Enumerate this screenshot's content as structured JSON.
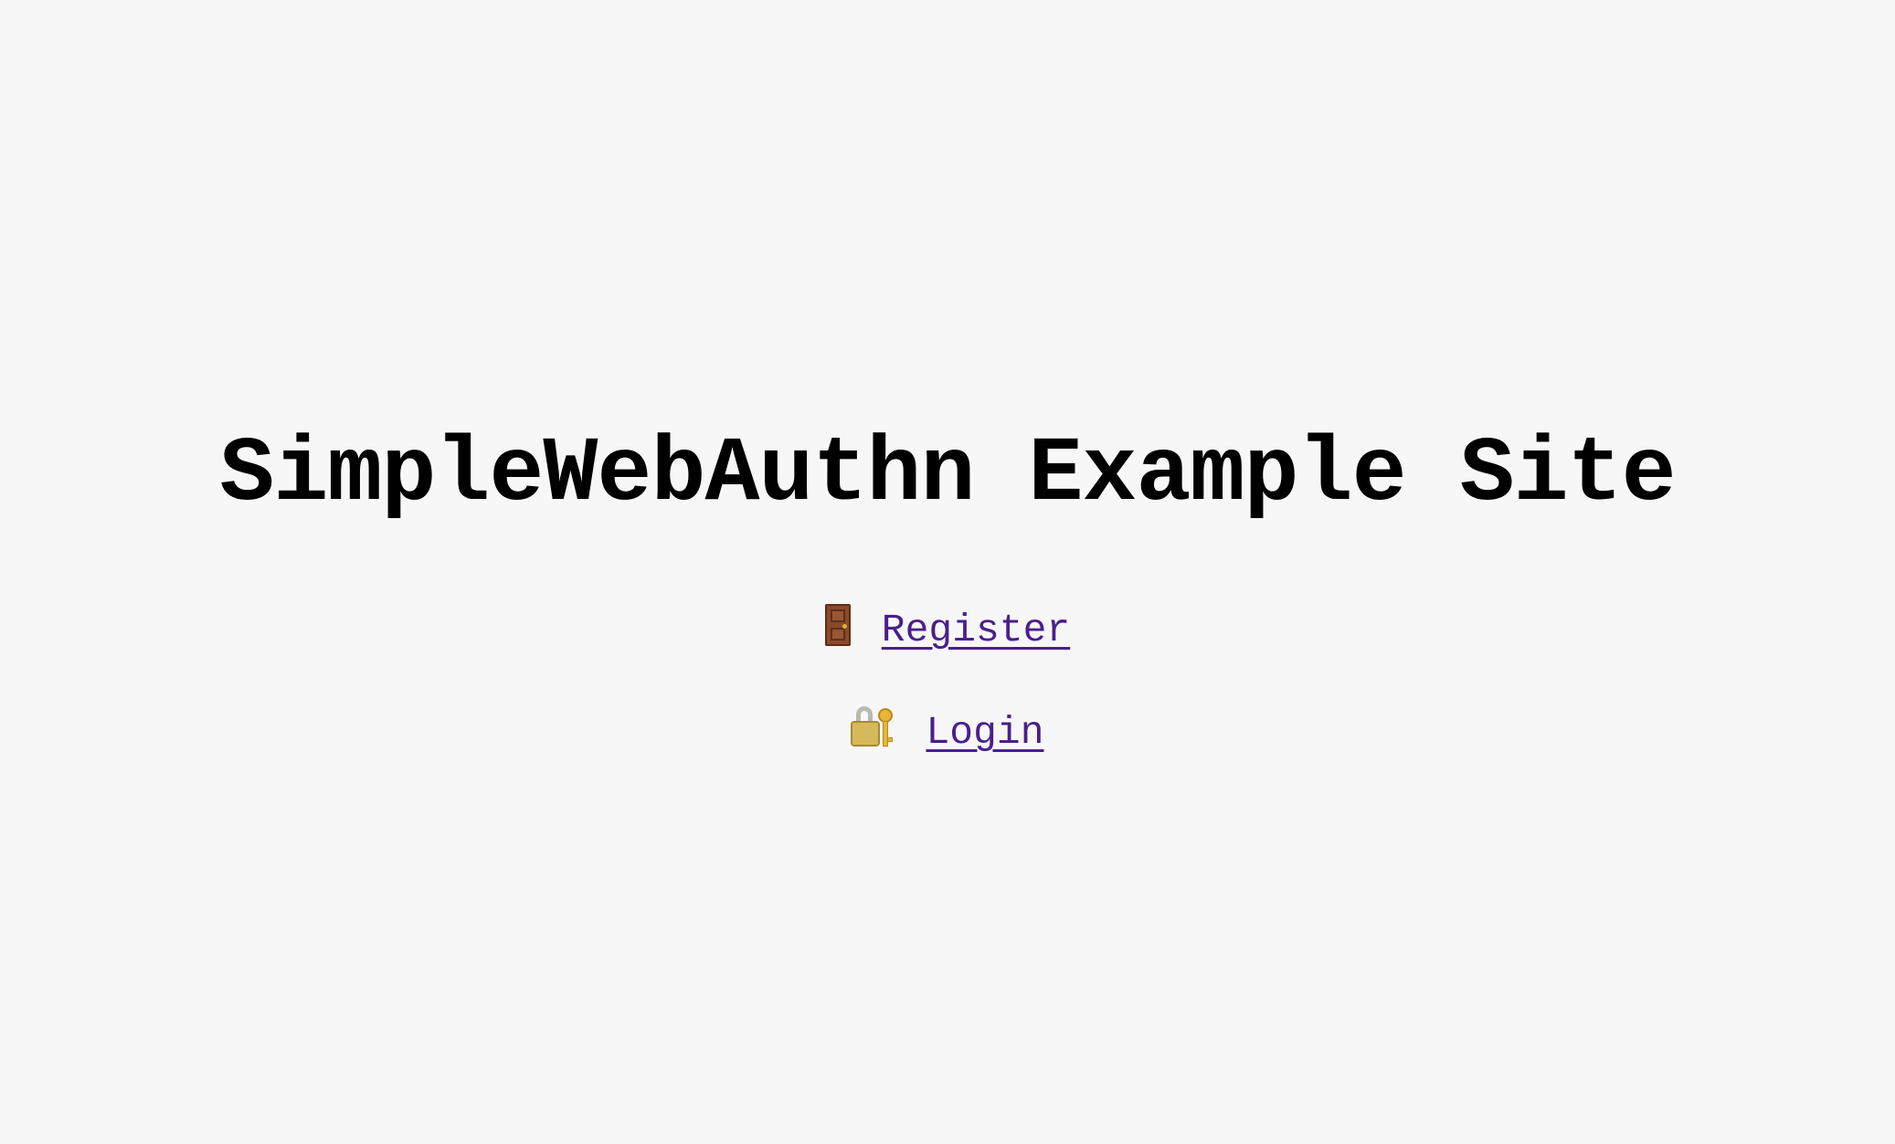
{
  "page": {
    "title": "SimpleWebAuthn Example Site"
  },
  "nav": {
    "register": {
      "icon": "door-icon",
      "label": "Register"
    },
    "login": {
      "icon": "lock-with-key-icon",
      "label": "Login"
    }
  },
  "colors": {
    "background": "#f7f7f7",
    "title": "#000000",
    "link": "#4a1f8c"
  }
}
